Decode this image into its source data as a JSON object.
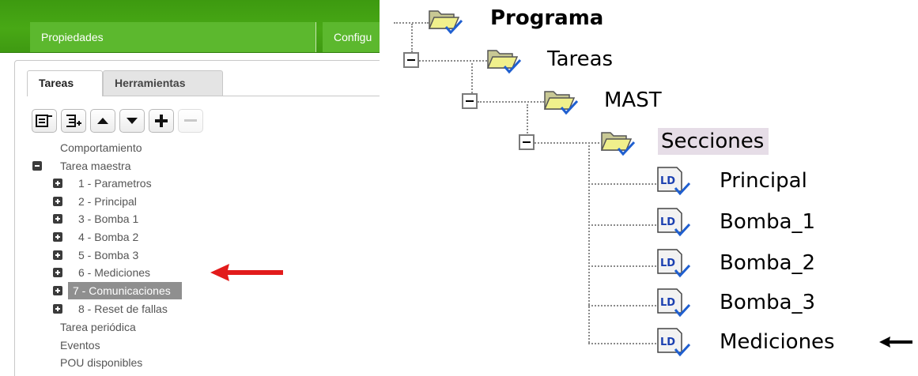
{
  "left": {
    "top_tabs": [
      "Propiedades",
      "Configu"
    ],
    "sub_tabs": {
      "active": "Tareas",
      "inactive": "Herramientas"
    },
    "toolbar_icons": [
      "collapse-all-icon",
      "expand-all-icon",
      "move-up-icon",
      "move-down-icon",
      "add-icon",
      "remove-icon"
    ],
    "tree": {
      "behavior": "Comportamiento",
      "master": "Tarea maestra",
      "master_children": [
        "1 - Parametros",
        "2 - Principal",
        "3 - Bomba 1",
        "4 - Bomba 2",
        "5 - Bomba 3",
        "6 - Mediciones",
        "7 - Comunicaciones",
        "8 - Reset de fallas"
      ],
      "selected": "7 - Comunicaciones",
      "periodic": "Tarea periódica",
      "events": "Eventos",
      "pou": "POU disponibles"
    },
    "arrow_color": "#e21b1b"
  },
  "right": {
    "program": "Programa",
    "tasks": "Tareas",
    "mast": "MAST",
    "sections": "Secciones",
    "ld_badge": "LD",
    "items": [
      "Principal",
      "Bomba_1",
      "Bomba_2",
      "Bomba_3",
      "Mediciones"
    ],
    "highlight_color": "#e6dde7"
  }
}
